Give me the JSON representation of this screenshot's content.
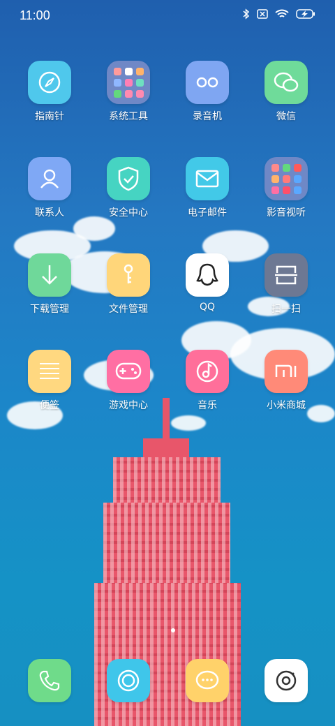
{
  "status_bar": {
    "time": "11:00"
  },
  "apps": [
    {
      "label": "指南针",
      "color": "#4fc8ec",
      "icon": "compass-icon"
    },
    {
      "label": "系统工具",
      "color": "#6f88c6",
      "icon": "folder-icon"
    },
    {
      "label": "录音机",
      "color": "#7fa6f2",
      "icon": "recorder-icon"
    },
    {
      "label": "微信",
      "color": "#6fdb9a",
      "icon": "wechat-icon"
    },
    {
      "label": "联系人",
      "color": "#7fa8f5",
      "icon": "contacts-icon"
    },
    {
      "label": "安全中心",
      "color": "#46d4c2",
      "icon": "shield-icon"
    },
    {
      "label": "电子邮件",
      "color": "#42c9e8",
      "icon": "mail-icon"
    },
    {
      "label": "影音视听",
      "color": "#6f88c6",
      "icon": "folder-icon"
    },
    {
      "label": "下载管理",
      "color": "#6fd89a",
      "icon": "download-icon"
    },
    {
      "label": "文件管理",
      "color": "#ffd67a",
      "icon": "file-manager-icon"
    },
    {
      "label": "QQ",
      "color": "#ffffff",
      "icon": "qq-icon"
    },
    {
      "label": "扫一扫",
      "color": "#6d7893",
      "icon": "scanner-icon"
    },
    {
      "label": "便签",
      "color": "#ffd880",
      "icon": "notes-icon"
    },
    {
      "label": "游戏中心",
      "color": "#ff6fa3",
      "icon": "gamepad-icon"
    },
    {
      "label": "音乐",
      "color": "#ff6f9a",
      "icon": "music-icon"
    },
    {
      "label": "小米商城",
      "color": "#ff8a78",
      "icon": "mi-store-icon"
    }
  ],
  "dock": [
    {
      "color": "#6fdb8a",
      "icon": "phone-icon"
    },
    {
      "color": "#3fc6ea",
      "icon": "browser-icon"
    },
    {
      "color": "#ffd26a",
      "icon": "messages-icon"
    },
    {
      "color": "#ffffff",
      "icon": "camera-icon"
    }
  ]
}
